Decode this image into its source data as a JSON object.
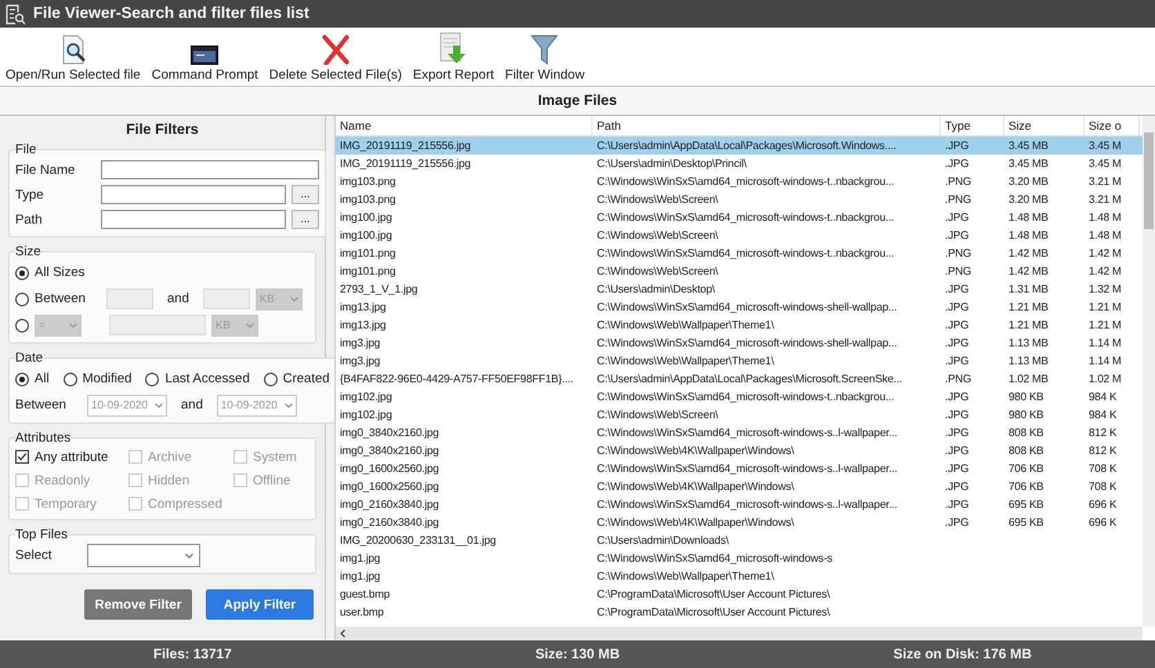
{
  "window": {
    "title": "File Viewer-Search and filter files list"
  },
  "toolbar": [
    {
      "kind": "open",
      "label": "Open/Run Selected file"
    },
    {
      "kind": "cmd",
      "label": "Command Prompt"
    },
    {
      "kind": "delete",
      "label": "Delete Selected File(s)"
    },
    {
      "kind": "export",
      "label": "Export Report"
    },
    {
      "kind": "filter",
      "label": "Filter Window"
    }
  ],
  "section_title": "Image Files",
  "filters": {
    "title": "File Filters",
    "file": {
      "legend": "File",
      "fields": [
        {
          "label": "File Name",
          "browse": false
        },
        {
          "label": "Type",
          "browse": true,
          "browse_label": "..."
        },
        {
          "label": "Path",
          "browse": true,
          "browse_label": "..."
        }
      ]
    },
    "size": {
      "legend": "Size",
      "all_label": "All Sizes",
      "all_selected": true,
      "between_label": "Between",
      "between_selected": false,
      "and_label": "and",
      "unit_1": "KB",
      "compare_selected": false,
      "operator": "=",
      "unit_2": "KB"
    },
    "date": {
      "legend": "Date",
      "options": [
        {
          "label": "All",
          "selected": true
        },
        {
          "label": "Modified",
          "selected": false
        },
        {
          "label": "Last Accessed",
          "selected": false
        },
        {
          "label": "Created",
          "selected": false
        }
      ],
      "between_label": "Between",
      "from": "10-09-2020",
      "and_label": "and",
      "to": "10-09-2020"
    },
    "attributes": {
      "legend": "Attributes",
      "items": [
        {
          "label": "Any attribute",
          "checked": true,
          "disabled": false
        },
        {
          "label": "Archive",
          "checked": false,
          "disabled": true
        },
        {
          "label": "System",
          "checked": false,
          "disabled": true
        },
        {
          "label": "Readonly",
          "checked": false,
          "disabled": true
        },
        {
          "label": "Hidden",
          "checked": false,
          "disabled": true
        },
        {
          "label": "Offline",
          "checked": false,
          "disabled": true
        },
        {
          "label": "Temporary",
          "checked": false,
          "disabled": true
        },
        {
          "label": "Compressed",
          "checked": false,
          "disabled": true
        }
      ]
    },
    "top_files": {
      "legend": "Top Files",
      "label": "Select"
    },
    "buttons": [
      {
        "label": "Remove Filter",
        "kind": "secondary"
      },
      {
        "label": "Apply Filter",
        "kind": "primary"
      }
    ]
  },
  "table": {
    "columns": [
      "Name",
      "Path",
      "Type",
      "Size",
      "Size o"
    ],
    "rows": [
      {
        "name": "IMG_20191119_215556.jpg",
        "path": "C:\\Users\\admin\\AppData\\Local\\Packages\\Microsoft.Windows....",
        "type": ".JPG",
        "size": "3.45 MB",
        "disk": "3.45 M",
        "selected": true
      },
      {
        "name": "IMG_20191119_215556.jpg",
        "path": "C:\\Users\\admin\\Desktop\\Princil\\",
        "type": ".JPG",
        "size": "3.45 MB",
        "disk": "3.45 M",
        "selected": false
      },
      {
        "name": "img103.png",
        "path": "C:\\Windows\\WinSxS\\amd64_microsoft-windows-t..nbackgrou...",
        "type": ".PNG",
        "size": "3.20 MB",
        "disk": "3.21 M",
        "selected": false
      },
      {
        "name": "img103.png",
        "path": "C:\\Windows\\Web\\Screen\\",
        "type": ".PNG",
        "size": "3.20 MB",
        "disk": "3.21 M",
        "selected": false
      },
      {
        "name": "img100.jpg",
        "path": "C:\\Windows\\WinSxS\\amd64_microsoft-windows-t..nbackgrou...",
        "type": ".JPG",
        "size": "1.48 MB",
        "disk": "1.48 M",
        "selected": false
      },
      {
        "name": "img100.jpg",
        "path": "C:\\Windows\\Web\\Screen\\",
        "type": ".JPG",
        "size": "1.48 MB",
        "disk": "1.48 M",
        "selected": false
      },
      {
        "name": "img101.png",
        "path": "C:\\Windows\\WinSxS\\amd64_microsoft-windows-t..nbackgrou...",
        "type": ".PNG",
        "size": "1.42 MB",
        "disk": "1.42 M",
        "selected": false
      },
      {
        "name": "img101.png",
        "path": "C:\\Windows\\Web\\Screen\\",
        "type": ".PNG",
        "size": "1.42 MB",
        "disk": "1.42 M",
        "selected": false
      },
      {
        "name": "2793_1_V_1.jpg",
        "path": "C:\\Users\\admin\\Desktop\\",
        "type": ".JPG",
        "size": "1.31 MB",
        "disk": "1.32 M",
        "selected": false
      },
      {
        "name": "img13.jpg",
        "path": "C:\\Windows\\WinSxS\\amd64_microsoft-windows-shell-wallpap...",
        "type": ".JPG",
        "size": "1.21 MB",
        "disk": "1.21 M",
        "selected": false
      },
      {
        "name": "img13.jpg",
        "path": "C:\\Windows\\Web\\Wallpaper\\Theme1\\",
        "type": ".JPG",
        "size": "1.21 MB",
        "disk": "1.21 M",
        "selected": false
      },
      {
        "name": "img3.jpg",
        "path": "C:\\Windows\\WinSxS\\amd64_microsoft-windows-shell-wallpap...",
        "type": ".JPG",
        "size": "1.13 MB",
        "disk": "1.14 M",
        "selected": false
      },
      {
        "name": "img3.jpg",
        "path": "C:\\Windows\\Web\\Wallpaper\\Theme1\\",
        "type": ".JPG",
        "size": "1.13 MB",
        "disk": "1.14 M",
        "selected": false
      },
      {
        "name": "{B4FAF822-96E0-4429-A757-FF50EF98FF1B}....",
        "path": "C:\\Users\\admin\\AppData\\Local\\Packages\\Microsoft.ScreenSke...",
        "type": ".PNG",
        "size": "1.02 MB",
        "disk": "1.02 M",
        "selected": false
      },
      {
        "name": "img102.jpg",
        "path": "C:\\Windows\\WinSxS\\amd64_microsoft-windows-t..nbackgrou...",
        "type": ".JPG",
        "size": "980 KB",
        "disk": "984 K",
        "selected": false
      },
      {
        "name": "img102.jpg",
        "path": "C:\\Windows\\Web\\Screen\\",
        "type": ".JPG",
        "size": "980 KB",
        "disk": "984 K",
        "selected": false
      },
      {
        "name": "img0_3840x2160.jpg",
        "path": "C:\\Windows\\WinSxS\\amd64_microsoft-windows-s..l-wallpaper...",
        "type": ".JPG",
        "size": "808 KB",
        "disk": "812 K",
        "selected": false
      },
      {
        "name": "img0_3840x2160.jpg",
        "path": "C:\\Windows\\Web\\4K\\Wallpaper\\Windows\\",
        "type": ".JPG",
        "size": "808 KB",
        "disk": "812 K",
        "selected": false
      },
      {
        "name": "img0_1600x2560.jpg",
        "path": "C:\\Windows\\WinSxS\\amd64_microsoft-windows-s..l-wallpaper...",
        "type": ".JPG",
        "size": "706 KB",
        "disk": "708 K",
        "selected": false
      },
      {
        "name": "img0_1600x2560.jpg",
        "path": "C:\\Windows\\Web\\4K\\Wallpaper\\Windows\\",
        "type": ".JPG",
        "size": "706 KB",
        "disk": "708 K",
        "selected": false
      },
      {
        "name": "img0_2160x3840.jpg",
        "path": "C:\\Windows\\WinSxS\\amd64_microsoft-windows-s..l-wallpaper...",
        "type": ".JPG",
        "size": "695 KB",
        "disk": "696 K",
        "selected": false
      },
      {
        "name": "img0_2160x3840.jpg",
        "path": "C:\\Windows\\Web\\4K\\Wallpaper\\Windows\\",
        "type": ".JPG",
        "size": "695 KB",
        "disk": "696 K",
        "selected": false
      },
      {
        "name": "IMG_20200630_233131__01.jpg",
        "path": "C:\\Users\\admin\\Downloads\\",
        "selected": false
      },
      {
        "name": "img1.jpg",
        "path": "C:\\Windows\\WinSxS\\amd64_microsoft-windows-s",
        "selected": false
      },
      {
        "name": "img1.jpg",
        "path": "C:\\Windows\\Web\\Wallpaper\\Theme1\\",
        "selected": false
      },
      {
        "name": "guest.bmp",
        "path": "C:\\ProgramData\\Microsoft\\User Account Pictures\\",
        "selected": false
      },
      {
        "name": "user.bmp",
        "path": "C:\\ProgramData\\Microsoft\\User Account Pictures\\",
        "selected": false
      }
    ]
  },
  "status_bar": [
    "Files: 13717",
    "Size: 130 MB",
    "Size on Disk: 176 MB"
  ]
}
